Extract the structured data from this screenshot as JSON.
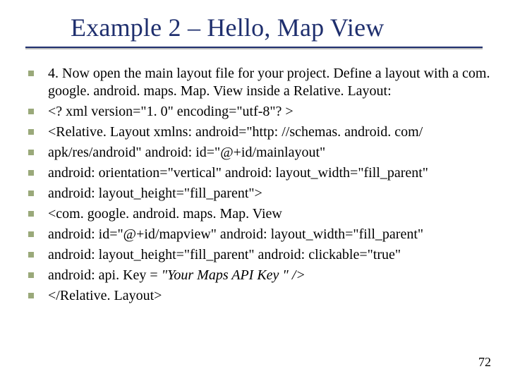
{
  "title": "Example 2 – Hello, Map View",
  "items": [
    "4.  Now open the main layout file for your project. Define a layout with a com. google. android. maps. Map. View inside a Relative. Layout:",
    "  <? xml version=\"1. 0\" encoding=\"utf-8\"? >",
    "  <Relative. Layout xmlns: android=\"http: //schemas. android. com/",
    "apk/res/android\" android: id=\"@+id/mainlayout\"",
    "android: orientation=\"vertical\" android: layout_width=\"fill_parent\"",
    "android: layout_height=\"fill_parent\">",
    "   <com. google. android. maps. Map. View",
    "   android: id=\"@+id/mapview\" android: layout_width=\"fill_parent\"",
    "   android: layout_height=\"fill_parent\" android: clickable=\"true\"",
    "   android: api. Key = ",
    "   </Relative. Layout>"
  ],
  "api_key_italic": "\"Your Maps API Key \" />",
  "page_number": "72"
}
